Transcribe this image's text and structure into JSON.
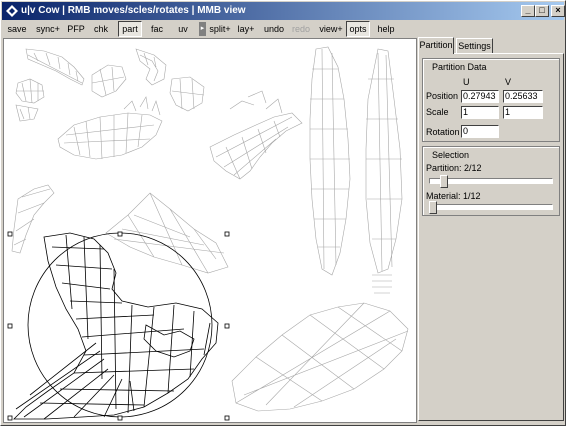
{
  "window": {
    "title": "u|v Cow | RMB moves/scles/rotates | MMB view",
    "min_glyph": "_",
    "max_glyph": "□",
    "close_glyph": "×"
  },
  "toolbar": {
    "items": [
      "save",
      "sync+",
      "PFP",
      "chk",
      "part",
      "fac",
      "uv",
      "split+",
      "lay+",
      "undo",
      "redo",
      "view+",
      "opts",
      "help"
    ],
    "pressed": [
      "part",
      "opts"
    ],
    "disabled": [
      "redo"
    ],
    "arrow_glyph": "▸"
  },
  "tabs": {
    "partition": "Partition",
    "settings": "Settings",
    "active": "Partition"
  },
  "partition_data": {
    "heading": "Partition Data",
    "u_header": "U",
    "v_header": "V",
    "position_label": "Position",
    "position_u": "0.27943",
    "position_v": "0.25633",
    "scale_label": "Scale",
    "scale_u": "1",
    "scale_v": "1",
    "rotation_label": "Rotation",
    "rotation": "0"
  },
  "selection": {
    "heading": "Selection",
    "partition_label": "Partition: 2/12",
    "partition_value": 2,
    "partition_total": 12,
    "material_label": "Material: 1/12",
    "material_value": 1,
    "material_total": 12
  },
  "colors": {
    "title_gradient_start": "#0a246a",
    "title_gradient_end": "#a6caf0",
    "face": "#d4d0c8",
    "mesh_faded": "#a8a8a8",
    "mesh_selected": "#000000"
  }
}
